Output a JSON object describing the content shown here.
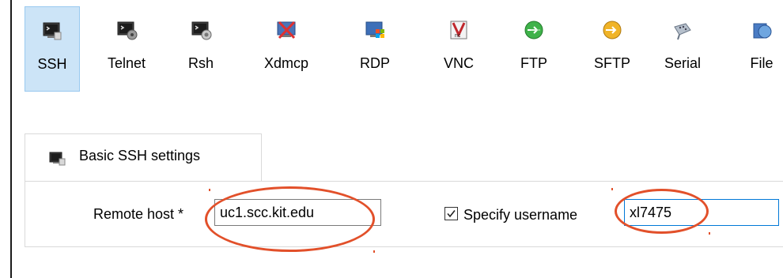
{
  "toolbar": {
    "items": [
      {
        "label": "SSH",
        "icon": "ssh-terminal-icon",
        "selected": true
      },
      {
        "label": "Telnet",
        "icon": "telnet-terminal-icon",
        "selected": false
      },
      {
        "label": "Rsh",
        "icon": "rsh-terminal-icon",
        "selected": false
      },
      {
        "label": "Xdmcp",
        "icon": "xdmcp-icon",
        "selected": false
      },
      {
        "label": "RDP",
        "icon": "rdp-icon",
        "selected": false
      },
      {
        "label": "VNC",
        "icon": "vnc-icon",
        "selected": false
      },
      {
        "label": "FTP",
        "icon": "ftp-globe-icon",
        "selected": false
      },
      {
        "label": "SFTP",
        "icon": "sftp-globe-icon",
        "selected": false
      },
      {
        "label": "Serial",
        "icon": "serial-connector-icon",
        "selected": false
      },
      {
        "label": "File",
        "icon": "file-globe-icon",
        "selected": false
      }
    ]
  },
  "tab": {
    "label": "Basic SSH settings",
    "icon": "ssh-terminal-icon"
  },
  "form": {
    "remote_host_label": "Remote host *",
    "remote_host_value": "uc1.scc.kit.edu",
    "specify_username_label": "Specify username",
    "specify_username_checked": true,
    "username_value": "xl7475"
  },
  "colors": {
    "selected_bg": "#cce4f7",
    "selected_border": "#99c9ef",
    "annotation": "#e2502a",
    "focus_border": "#0078d7"
  }
}
